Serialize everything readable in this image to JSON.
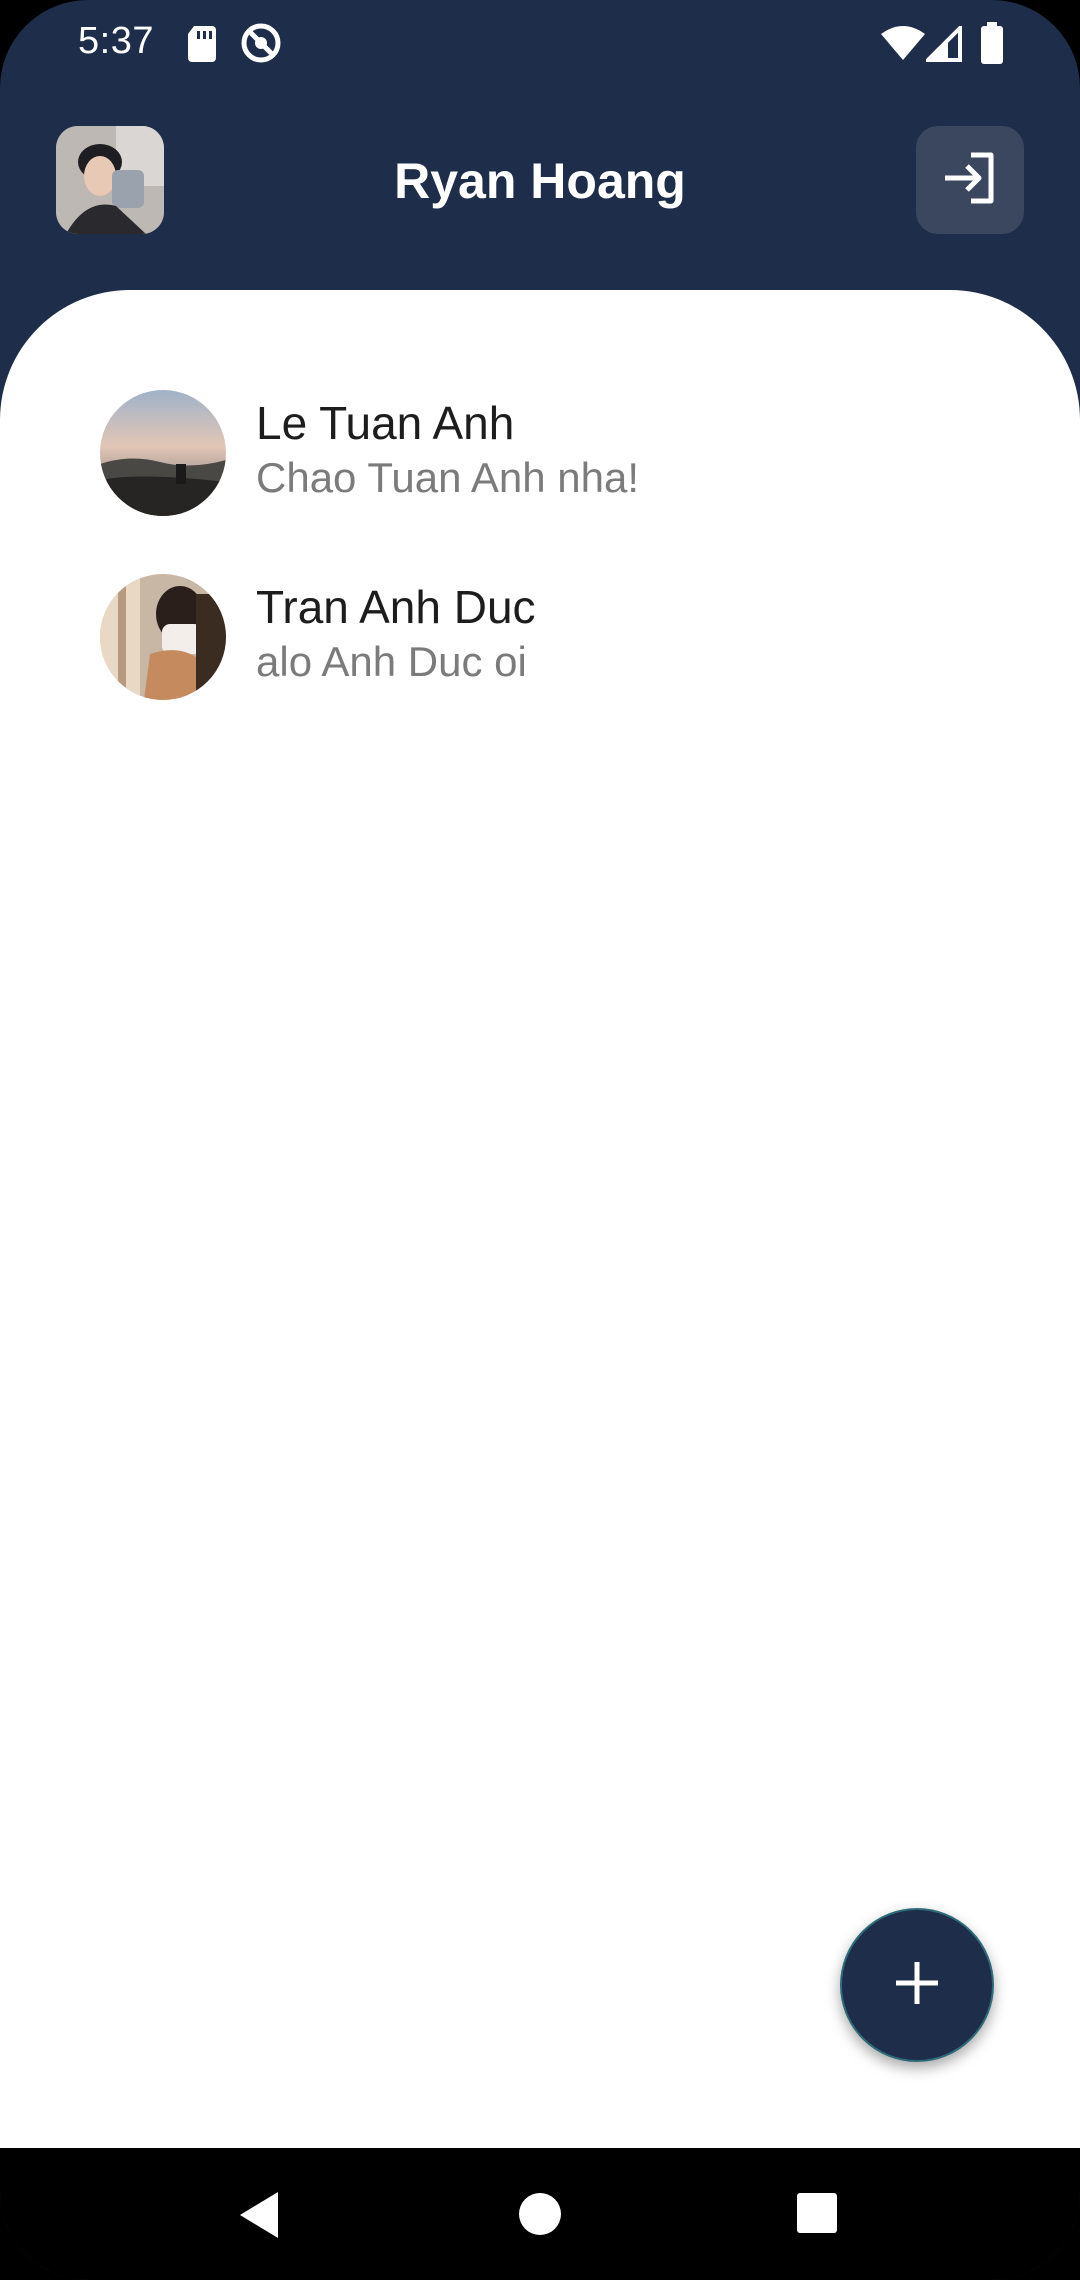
{
  "status_bar": {
    "time": "5:37",
    "icons": [
      "sd-card-icon",
      "no-disturb-icon",
      "wifi-icon",
      "signal-icon",
      "battery-icon"
    ]
  },
  "header": {
    "title": "Ryan Hoang",
    "avatar_icon": "profile-avatar",
    "logout_icon": "logout-icon",
    "background_color": "#1e2d49"
  },
  "conversations": [
    {
      "name": "Le Tuan Anh",
      "last_message": "Chao Tuan Anh nha!"
    },
    {
      "name": "Tran Anh Duc",
      "last_message": "alo Anh Duc oi"
    }
  ],
  "fab": {
    "icon": "plus-icon"
  },
  "navigation": {
    "icons": [
      "back-icon",
      "home-icon",
      "recents-icon"
    ]
  },
  "colors": {
    "primary": "#1e2d49",
    "name_text": "#1d1d1d",
    "message_text": "#7b7b7b"
  }
}
